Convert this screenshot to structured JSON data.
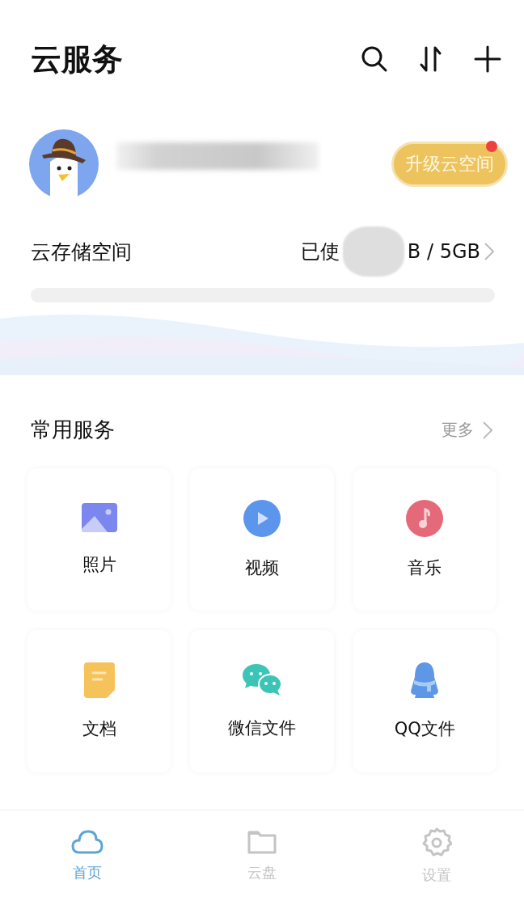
{
  "header": {
    "title": "云服务"
  },
  "account": {
    "upgrade_button": "升级云空间",
    "upgrade_badge": true
  },
  "storage": {
    "label": "云存储空间",
    "usage_prefix": "已使",
    "usage_suffix": "B / 5GB"
  },
  "services": {
    "title": "常用服务",
    "more": "更多",
    "items": [
      {
        "kind": "photo",
        "label": "照片"
      },
      {
        "kind": "video",
        "label": "视频"
      },
      {
        "kind": "music",
        "label": "音乐"
      },
      {
        "kind": "document",
        "label": "文档"
      },
      {
        "kind": "chat",
        "label": "微信文件"
      },
      {
        "kind": "penguin",
        "label": "QQ文件"
      }
    ]
  },
  "bottom_nav": [
    {
      "kind": "cloud",
      "label": "首页",
      "selected": true
    },
    {
      "kind": "folder",
      "label": "云盘",
      "selected": false
    },
    {
      "kind": "gear",
      "label": "设置",
      "selected": false
    }
  ]
}
